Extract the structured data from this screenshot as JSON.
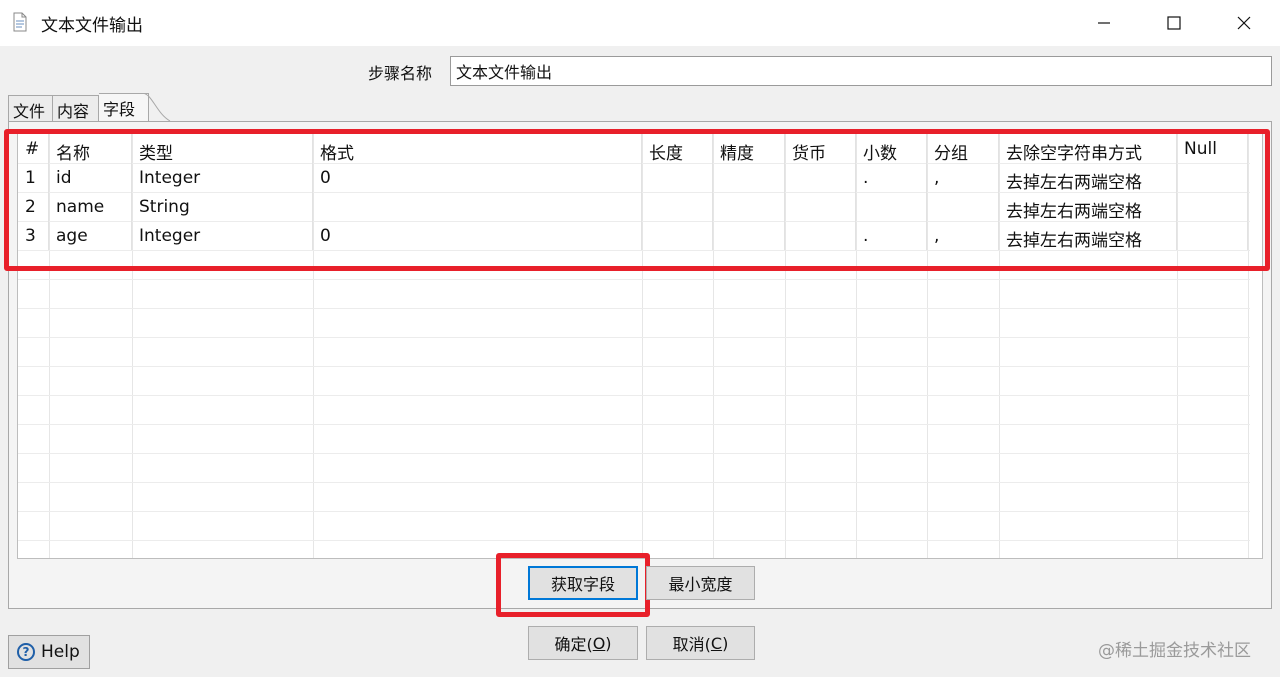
{
  "window": {
    "title": "文本文件输出"
  },
  "step": {
    "label": "步骤名称",
    "value": "文本文件输出"
  },
  "tabs": [
    {
      "label": "文件"
    },
    {
      "label": "内容"
    },
    {
      "label": "字段"
    }
  ],
  "table": {
    "columns": [
      "#",
      "名称",
      "类型",
      "格式",
      "长度",
      "精度",
      "货币",
      "小数",
      "分组",
      "去除空字符串方式",
      "Null"
    ],
    "rows": [
      [
        "1",
        "id",
        "Integer",
        "0",
        "",
        "",
        "",
        ".",
        ",",
        "去掉左右两端空格",
        ""
      ],
      [
        "2",
        "name",
        "String",
        "",
        "",
        "",
        "",
        "",
        "",
        "去掉左右两端空格",
        ""
      ],
      [
        "3",
        "age",
        "Integer",
        "0",
        "",
        "",
        "",
        ".",
        ",",
        "去掉左右两端空格",
        ""
      ]
    ]
  },
  "buttons": {
    "get_fields": "获取字段",
    "min_width": "最小宽度",
    "ok": "确定(",
    "ok_key": "O",
    "ok_end": ")",
    "cancel": "取消(",
    "cancel_key": "C",
    "cancel_end": ")",
    "help": "Help"
  },
  "watermark": "@稀土掘金技术社区",
  "colors": {
    "highlight": "#e8202a",
    "focus": "#0078d7"
  },
  "icons": [
    "document-icon",
    "minimize-icon",
    "maximize-icon",
    "close-icon",
    "help-icon"
  ]
}
